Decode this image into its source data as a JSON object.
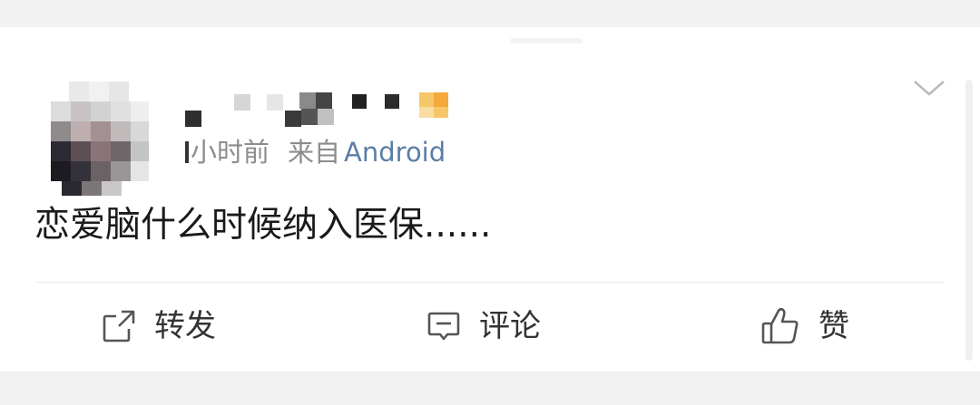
{
  "post": {
    "time_prefix": "小时前",
    "source_prefix": "来自",
    "client": "Android",
    "text": "恋爱脑什么时候纳入医保......"
  },
  "actions": {
    "repost": "转发",
    "comment": "评论",
    "like": "赞"
  },
  "icons": [
    "repost-icon",
    "comment-icon",
    "like-icon",
    "chevron-down-icon"
  ],
  "colors": {
    "background": "#f2f2f2",
    "card": "#ffffff",
    "client_link": "#5b7ea6",
    "meta": "#8c8c8c",
    "text": "#1a1a1a"
  }
}
